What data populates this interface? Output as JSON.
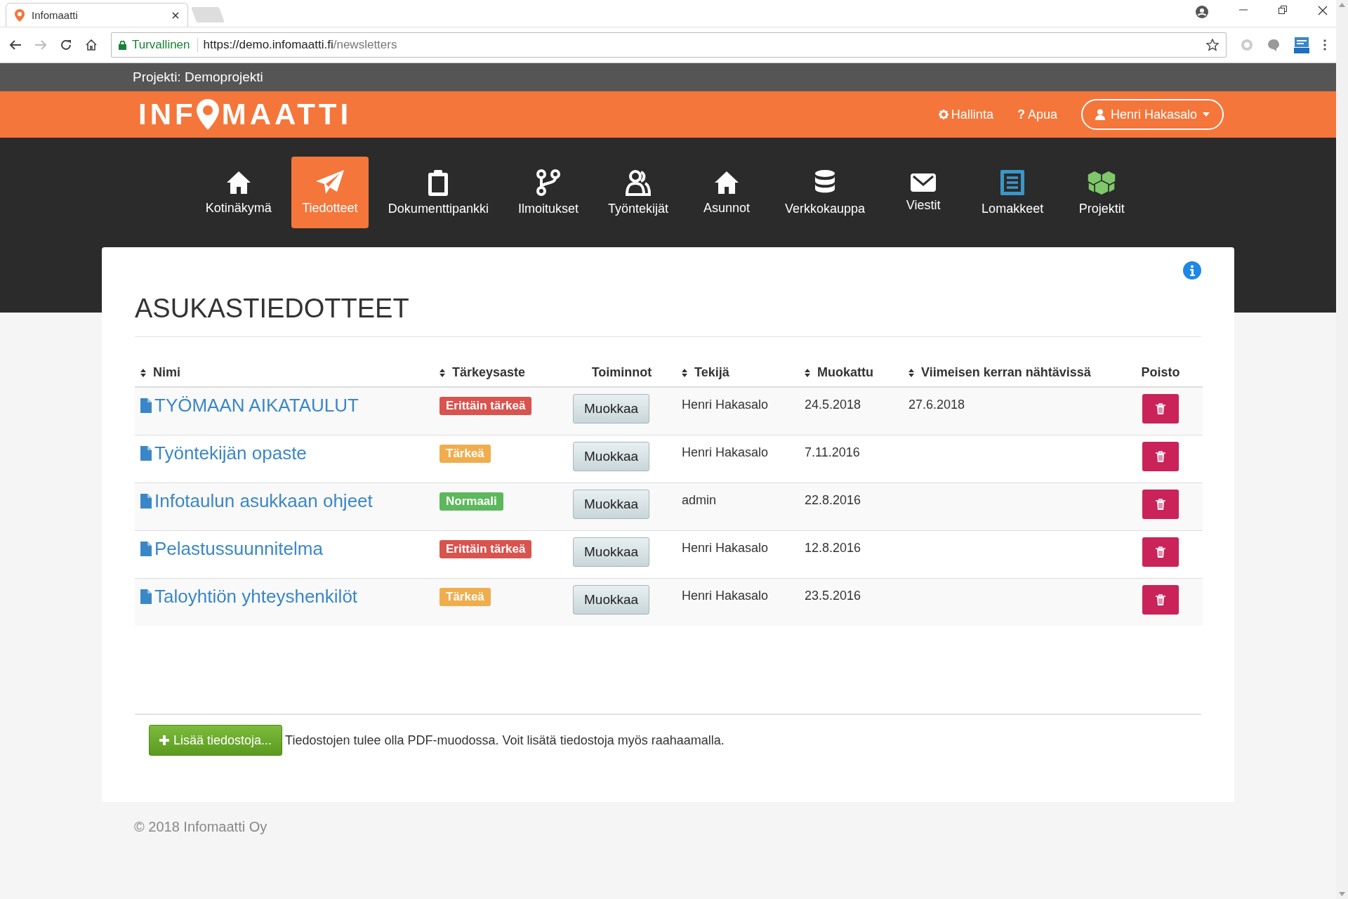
{
  "browser": {
    "tab": {
      "title": "Infomaatti"
    },
    "security_label": "Turvallinen",
    "url_host": "https://demo.infomaatti.fi",
    "url_path": "/newsletters"
  },
  "project_bar": {
    "label": "Projekti: Demoprojekti"
  },
  "header": {
    "logo_parts": [
      "INF",
      "MAATTI"
    ],
    "links": [
      {
        "kind": "gear",
        "label": "Hallinta"
      },
      {
        "kind": "help",
        "icon_text": "?",
        "label": "Apua"
      }
    ],
    "user_menu": {
      "label": "Henri Hakasalo"
    }
  },
  "nav": [
    {
      "label": "Kotinäkymä",
      "selected": false
    },
    {
      "label": "Tiedotteet",
      "selected": true
    },
    {
      "label": "Dokumenttipankki",
      "selected": false
    },
    {
      "label": "Ilmoitukset",
      "selected": false
    },
    {
      "label": "Työntekijät",
      "selected": false
    },
    {
      "label": "Asunnot",
      "selected": false
    },
    {
      "label": "Verkkokauppa",
      "selected": false
    },
    {
      "label": "Viestit",
      "selected": false
    },
    {
      "label": "Lomakkeet",
      "selected": false
    },
    {
      "label": "Projektit",
      "selected": false
    }
  ],
  "page": {
    "title": "ASUKASTIEDOTTEET",
    "table": {
      "columns": [
        {
          "label": "Nimi",
          "sortable": true
        },
        {
          "label": "Tärkeysaste",
          "sortable": true
        },
        {
          "label": "Toiminnot",
          "sortable": false
        },
        {
          "label": "Tekijä",
          "sortable": true
        },
        {
          "label": "Muokattu",
          "sortable": true
        },
        {
          "label": "Viimeisen kerran nähtävissä",
          "sortable": true
        },
        {
          "label": "Poisto",
          "sortable": false
        }
      ],
      "rows": [
        {
          "name": "TYÖMAAN AIKATAULUT",
          "importance": {
            "label": "Erittäin tärkeä",
            "color": "#d9534f"
          },
          "action": "Muokkaa",
          "author": "Henri Hakasalo",
          "modified": "24.5.2018",
          "visible_until": "27.6.2018"
        },
        {
          "name": "Työntekijän opaste",
          "importance": {
            "label": "Tärkeä",
            "color": "#f0ad4e"
          },
          "action": "Muokkaa",
          "author": "Henri Hakasalo",
          "modified": "7.11.2016"
        },
        {
          "name": "Infotaulun asukkaan ohjeet",
          "importance": {
            "label": "Normaali",
            "color": "#5cb85c"
          },
          "action": "Muokkaa",
          "author": "admin",
          "modified": "22.8.2016"
        },
        {
          "name": "Pelastussuunnitelma",
          "importance": {
            "label": "Erittäin tärkeä",
            "color": "#d9534f"
          },
          "action": "Muokkaa",
          "author": "Henri Hakasalo",
          "modified": "12.8.2016"
        },
        {
          "name": "Taloyhtiön yhteyshenkilöt",
          "importance": {
            "label": "Tärkeä",
            "color": "#f0ad4e"
          },
          "action": "Muokkaa",
          "author": "Henri Hakasalo",
          "modified": "23.5.2016"
        }
      ]
    },
    "add_button": "Lisää tiedostoja...",
    "hint": "Tiedostojen tulee olla PDF-muodossa. Voit lisätä tiedostoja myös raahaamalla."
  },
  "footer": "© 2018 Infomaatti Oy"
}
